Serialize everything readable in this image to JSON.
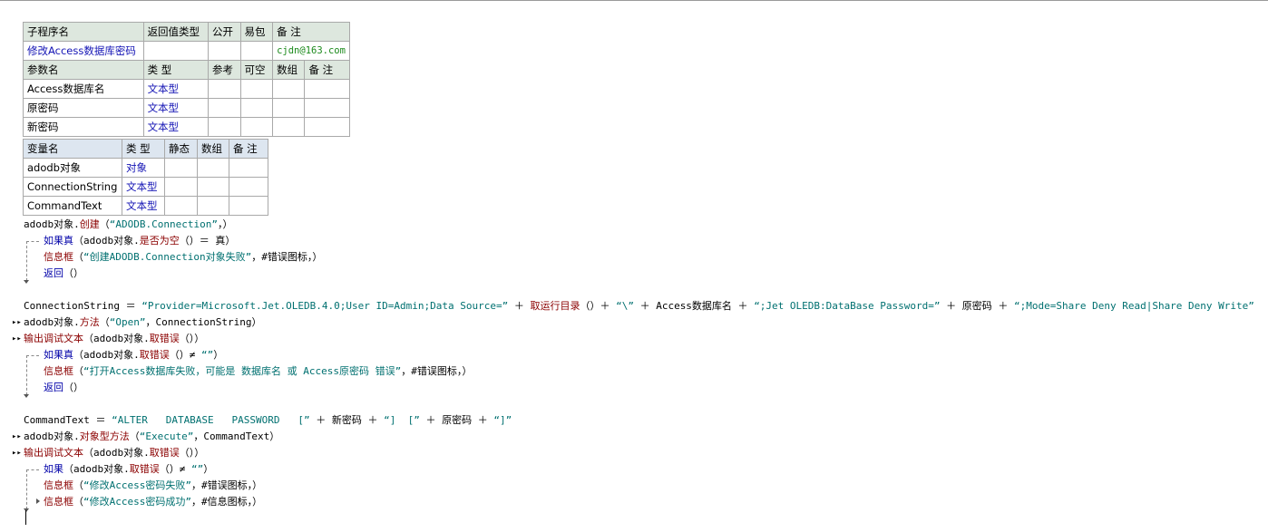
{
  "sub_table": {
    "headers": [
      "子程序名",
      "返回值类型",
      "公开",
      "易包",
      "备 注"
    ],
    "name": "修改Access数据库密码",
    "return_type": "",
    "public": "",
    "epackage": "",
    "note": "cjdn@163.com",
    "param_headers": [
      "参数名",
      "类 型",
      "参考",
      "可空",
      "数组",
      "备 注"
    ],
    "params": [
      {
        "name": "Access数据库名",
        "type": "文本型"
      },
      {
        "name": "原密码",
        "type": "文本型"
      },
      {
        "name": "新密码",
        "type": "文本型"
      }
    ]
  },
  "var_table": {
    "headers": [
      "变量名",
      "类 型",
      "静态",
      "数组",
      "备 注"
    ],
    "vars": [
      {
        "name": "adodb对象",
        "type": "对象"
      },
      {
        "name": "ConnectionString",
        "type": "文本型"
      },
      {
        "name": "CommandText",
        "type": "文本型"
      }
    ]
  },
  "code": {
    "l1": [
      "adodb对象.",
      "创建",
      "（",
      "“ADODB.Connection”",
      "，）"
    ],
    "l2": [
      "如果真",
      "（adodb对象.",
      "是否为空",
      "（）＝ 真）"
    ],
    "l3": [
      "信息框",
      "（",
      "“创建ADODB.Connection对象失败”",
      "，#错误图标，）"
    ],
    "l4": [
      "返回",
      "（）"
    ],
    "l5": [
      "ConnectionString ＝ ",
      "“Provider=Microsoft.Jet.OLEDB.4.0;User ID=Admin;Data Source=”",
      " ＋ ",
      "取运行目录",
      "（）＋ ",
      "“\\”",
      " ＋ Access数据库名 ＋ ",
      "“;Jet OLEDB:DataBase Password=”",
      " ＋ 原密码 ＋ ",
      "“;Mode=Share Deny Read|Share Deny Write”"
    ],
    "l6": [
      "adodb对象.",
      "方法",
      "（",
      "“Open”",
      "，ConnectionString）"
    ],
    "l7": [
      "输出调试文本",
      "（adodb对象.",
      "取错误",
      "（））"
    ],
    "l8": [
      "如果真",
      "（adodb对象.",
      "取错误",
      "（）≠ ",
      "“”",
      "）"
    ],
    "l9": [
      "信息框",
      "（",
      "“打开Access数据库失败，可能是 数据库名 或 Access原密码 错误”",
      "，#错误图标，）"
    ],
    "l10": [
      "返回",
      "（）"
    ],
    "l11": [
      "CommandText ＝ ",
      "“ALTER   DATABASE   PASSWORD   [”",
      " ＋ 新密码 ＋ ",
      "“]  [”",
      " ＋ 原密码 ＋ ",
      "“]”"
    ],
    "l12": [
      "adodb对象.",
      "对象型方法",
      "（",
      "“Execute”",
      "，CommandText）"
    ],
    "l13": [
      "输出调试文本",
      "（adodb对象.",
      "取错误",
      "（））"
    ],
    "l14": [
      "如果",
      "（adodb对象.",
      "取错误",
      "（）≠ ",
      "“”",
      "）"
    ],
    "l15": [
      "信息框",
      "（",
      "“修改Access密码失败”",
      "，#错误图标，）"
    ],
    "l16": [
      "信息框",
      "（",
      "“修改Access密码成功”",
      "，#信息图标，）"
    ]
  }
}
